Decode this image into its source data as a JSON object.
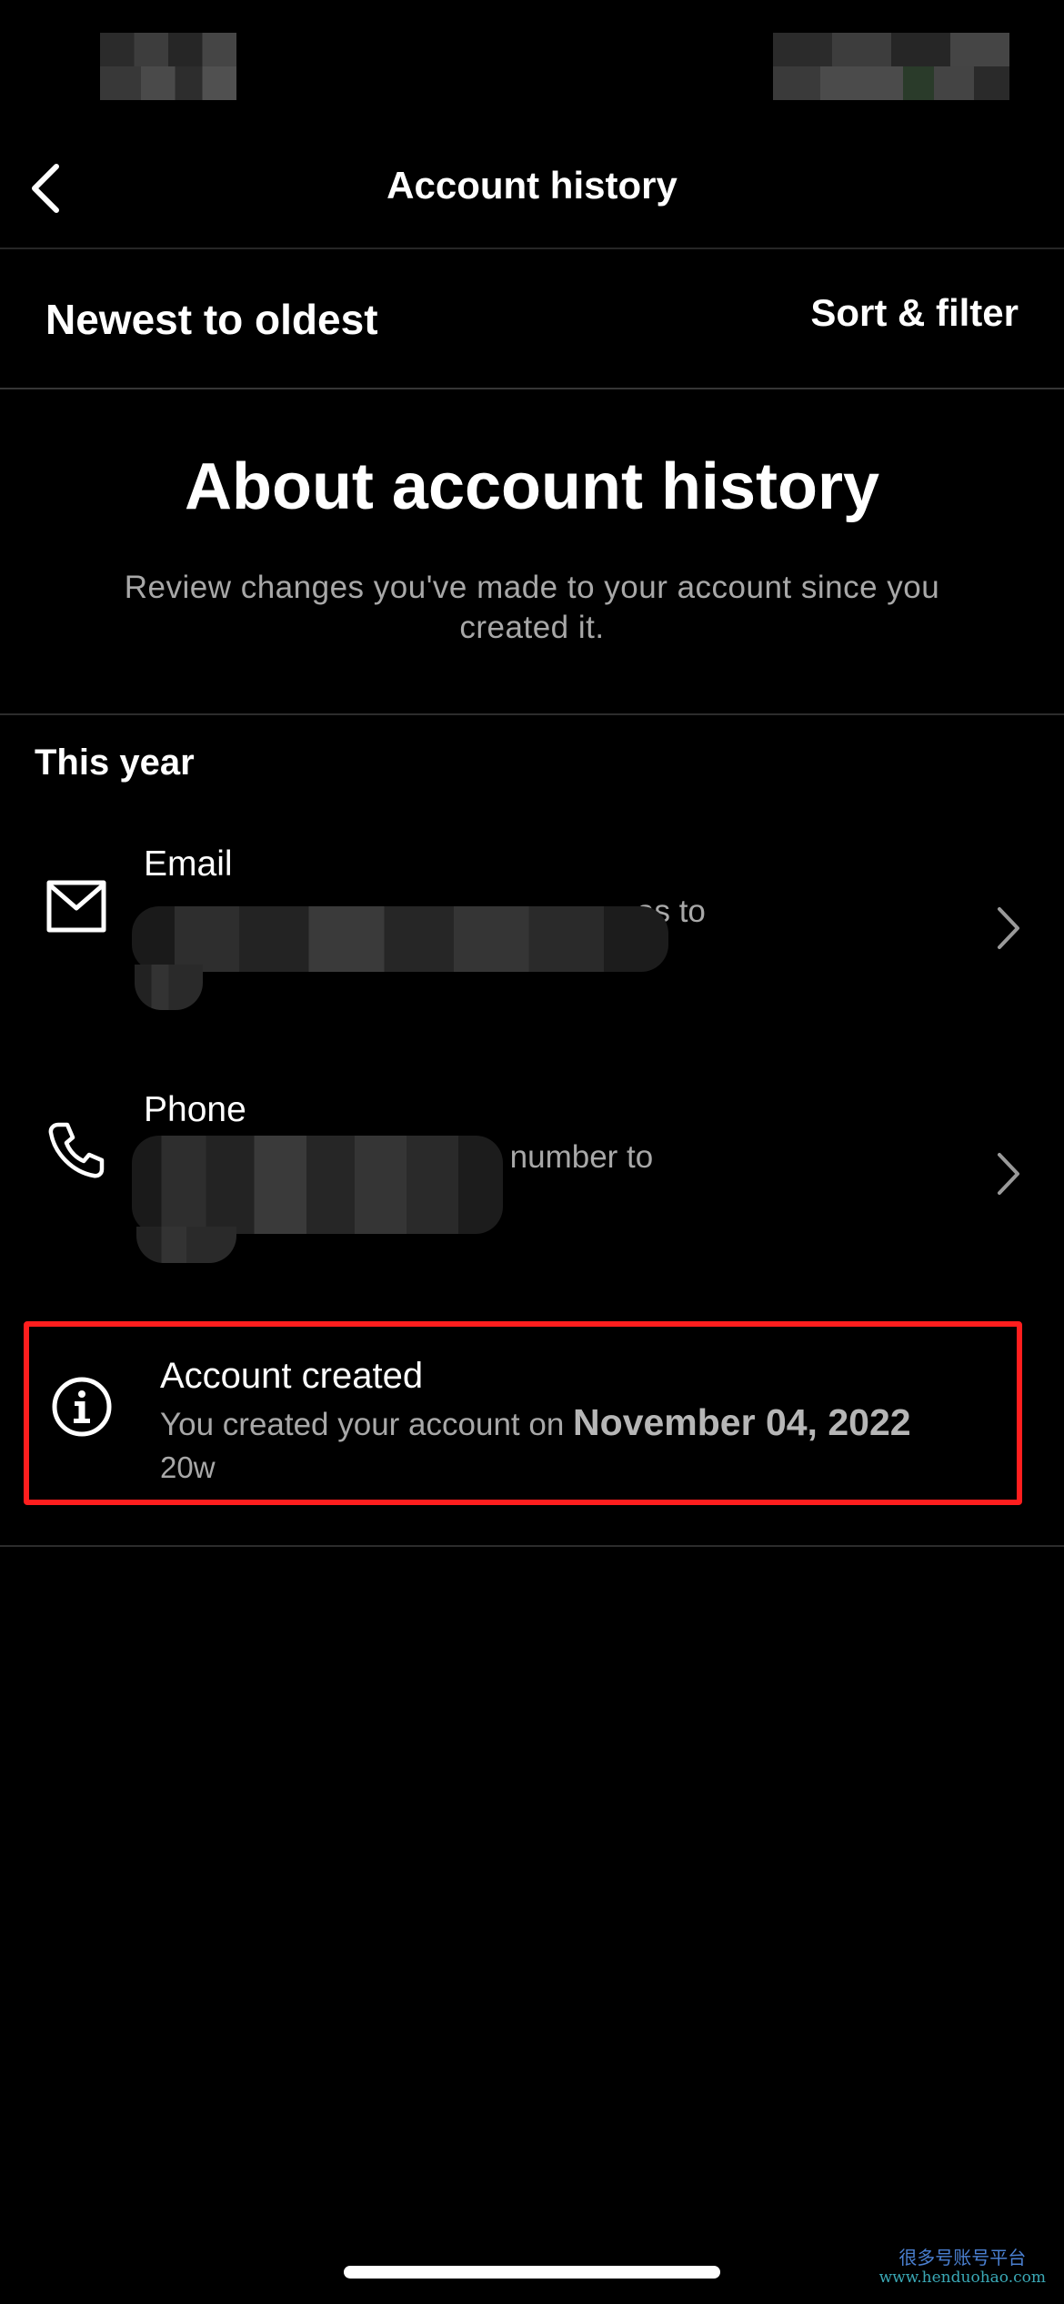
{
  "nav": {
    "title": "Account history"
  },
  "sort": {
    "order_label": "Newest to oldest",
    "filter_label": "Sort & filter"
  },
  "about": {
    "title": "About account history",
    "description": "Review changes you've made to your account since you created it."
  },
  "section": {
    "header": "This year"
  },
  "items": [
    {
      "title": "Email",
      "icon": "mail-icon",
      "subtitle_visible": "as to"
    },
    {
      "title": "Phone",
      "icon": "phone-icon",
      "subtitle_visible": "ne number to"
    }
  ],
  "account_created": {
    "title": "Account created",
    "subtitle_prefix": "You created your account on",
    "date": "November 04, 2022",
    "time_ago": "20w",
    "icon": "info-icon",
    "highlight_color": "#ff1e1e"
  },
  "watermark": {
    "line1": "很多号账号平台",
    "line2": "www.henduohao.com"
  }
}
